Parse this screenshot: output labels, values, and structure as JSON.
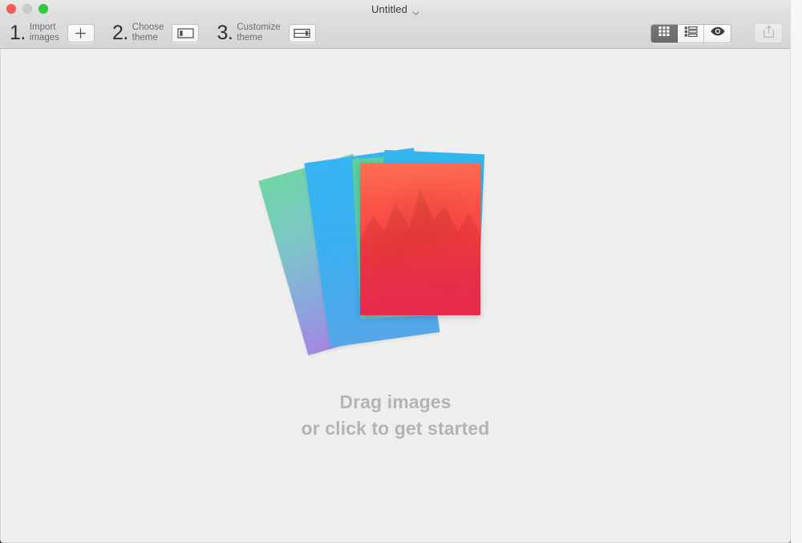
{
  "window": {
    "title": "Untitled",
    "title_chevron_icon": "chevron-down-icon",
    "traffic_lights": [
      {
        "name": "close",
        "label": "Close",
        "color": "#fb5b53"
      },
      {
        "name": "minimize",
        "label": "Minimize",
        "color": "#cbcbcb"
      },
      {
        "name": "zoom",
        "label": "Zoom",
        "color": "#2bcb40"
      }
    ]
  },
  "toolbar": {
    "steps": [
      {
        "number": "1.",
        "label_line1": "Import",
        "label_line2": "images",
        "button_icon": "plus-icon",
        "button_tooltip": "Import images"
      },
      {
        "number": "2.",
        "label_line1": "Choose",
        "label_line2": "theme",
        "button_icon": "theme-layout-left-icon",
        "button_tooltip": "Choose theme"
      },
      {
        "number": "3.",
        "label_line1": "Customize",
        "label_line2": "theme",
        "button_icon": "theme-customize-icon",
        "button_tooltip": "Customize theme"
      }
    ],
    "view_modes": [
      {
        "name": "grid",
        "icon": "grid-view-icon",
        "label": "Grid view",
        "active": true
      },
      {
        "name": "list",
        "icon": "list-view-icon",
        "label": "List view",
        "active": false
      },
      {
        "name": "preview",
        "icon": "eye-preview-icon",
        "label": "Preview",
        "active": false
      }
    ],
    "share": {
      "icon": "share-export-icon",
      "label": "Share",
      "enabled": false
    }
  },
  "content": {
    "empty_state": {
      "illustration": "stacked-photo-cards",
      "card_colors": [
        "#6fd6a4",
        "#35b6f2",
        "#5fcf9b",
        "#34b5f0",
        "#fb4343"
      ],
      "headline": "Drag images",
      "subline": "or click to get started"
    }
  },
  "colors": {
    "toolbar_bg": "#d8d8d8",
    "content_bg": "#efefef",
    "placeholder_text": "#b4b4b4",
    "step_number": "#303030",
    "step_label": "#6e6e6e",
    "segment_active_bg": "#6f6f6f"
  }
}
